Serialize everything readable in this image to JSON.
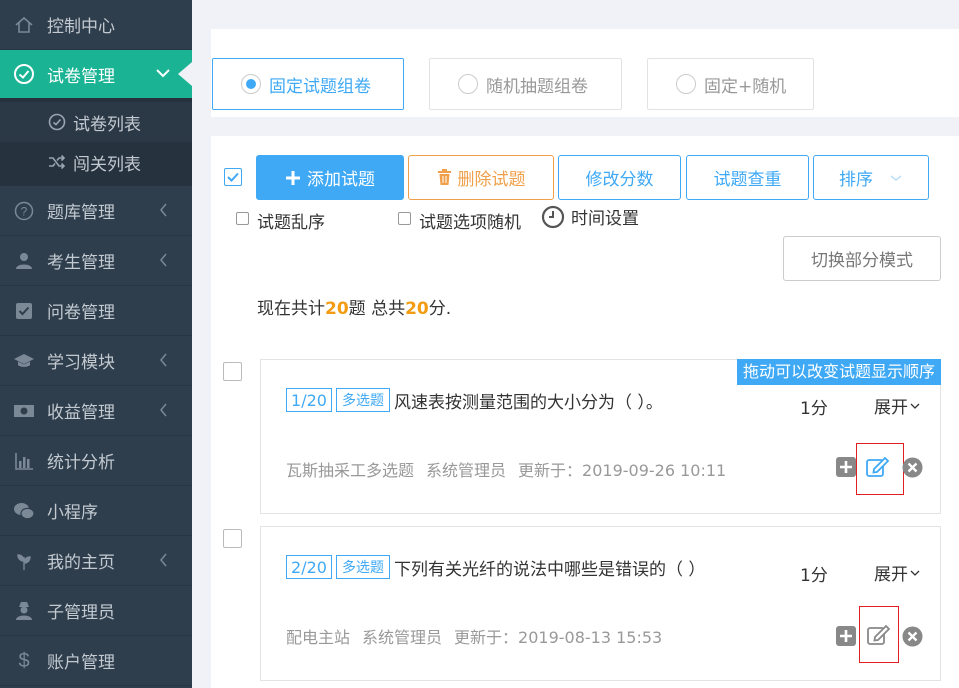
{
  "sidebar": {
    "items": [
      {
        "label": "控制中心",
        "icon": "home-icon"
      },
      {
        "label": "试卷管理",
        "icon": "check-circle-icon"
      },
      {
        "label": "题库管理",
        "icon": "question-circle-icon"
      },
      {
        "label": "考生管理",
        "icon": "user-icon"
      },
      {
        "label": "问卷管理",
        "icon": "check-square-icon"
      },
      {
        "label": "学习模块",
        "icon": "graduation-cap-icon"
      },
      {
        "label": "收益管理",
        "icon": "money-icon"
      },
      {
        "label": "统计分析",
        "icon": "bar-chart-icon"
      },
      {
        "label": "小程序",
        "icon": "wechat-icon"
      },
      {
        "label": "我的主页",
        "icon": "leaf-icon"
      },
      {
        "label": "子管理员",
        "icon": "user-secret-icon"
      },
      {
        "label": "账户管理",
        "icon": "dollar-icon"
      }
    ],
    "sub_items": [
      {
        "label": "试卷列表",
        "icon": "check-circle-icon"
      },
      {
        "label": "闯关列表",
        "icon": "random-icon"
      }
    ]
  },
  "modes": {
    "fixed": "固定试题组卷",
    "random": "随机抽题组卷",
    "mixed": "固定+随机"
  },
  "toolbar": {
    "add": "添加试题",
    "delete": "删除试题",
    "modify_score": "修改分数",
    "dedupe": "试题查重",
    "sort": "排序"
  },
  "options": {
    "shuffle": "试题乱序",
    "option_random": "试题选项随机",
    "time_setting": "时间设置"
  },
  "switch_mode": "切换部分模式",
  "summary": {
    "prefix": "现在共计",
    "count": "20",
    "mid": "题 总共",
    "score": "20",
    "suffix": "分."
  },
  "drag_tip": "拖动可以改变试题显示顺序",
  "questions": [
    {
      "num": "1/20",
      "type": "多选题",
      "text": "风速表按测量范围的大小分为（ ）。",
      "score": "1分",
      "expand": "展开",
      "category": "瓦斯抽采工多选题",
      "author": "系统管理员",
      "updated": "更新于：2019-09-26 10:11"
    },
    {
      "num": "2/20",
      "type": "多选题",
      "text": "下列有关光纤的说法中哪些是错误的（ ）",
      "score": "1分",
      "expand": "展开",
      "category": "配电主站",
      "author": "系统管理员",
      "updated": "更新于：2019-08-13 15:53"
    }
  ],
  "colors": {
    "sidebar_bg": "#2f3e4d",
    "active": "#1ab394",
    "primary": "#3fa9f5",
    "warning": "#f0a04b",
    "highlight_number": "#f39c12",
    "annotation_box": "#e02020"
  }
}
